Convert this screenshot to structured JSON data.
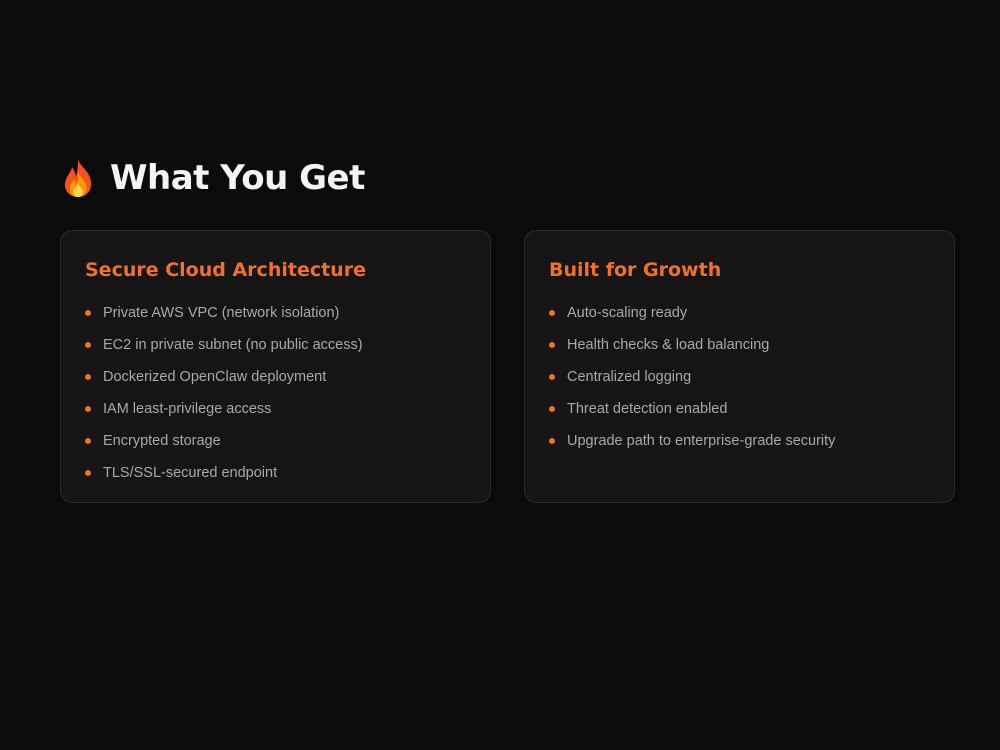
{
  "section": {
    "icon": "flame-icon",
    "title": "What You Get"
  },
  "accent_color": "#f36f2a",
  "cards": [
    {
      "title": "Secure Cloud Architecture",
      "items": [
        "Private AWS VPC (network isolation)",
        "EC2 in private subnet (no public access)",
        "Dockerized OpenClaw deployment",
        "IAM least-privilege access",
        "Encrypted storage",
        "TLS/SSL-secured endpoint"
      ]
    },
    {
      "title": "Built for Growth",
      "items": [
        "Auto-scaling ready",
        "Health checks & load balancing",
        "Centralized logging",
        "Threat detection enabled",
        "Upgrade path to enterprise-grade security"
      ]
    }
  ]
}
